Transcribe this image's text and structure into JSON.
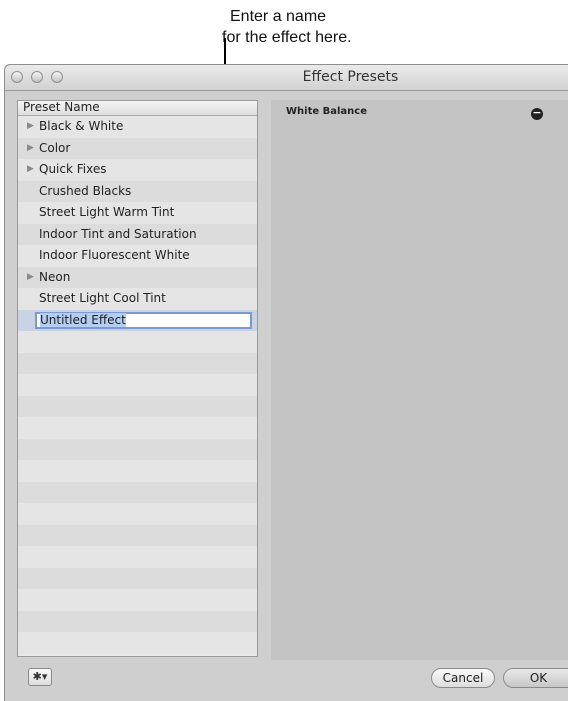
{
  "annotation": {
    "line1": "Enter a name",
    "line2": "for the effect here."
  },
  "window": {
    "title": "Effect Presets"
  },
  "presets": {
    "column_header": "Preset Name",
    "items": [
      {
        "label": "Black & White",
        "expandable": true
      },
      {
        "label": "Color",
        "expandable": true
      },
      {
        "label": "Quick Fixes",
        "expandable": true
      },
      {
        "label": "Crushed Blacks",
        "expandable": false
      },
      {
        "label": "Street Light Warm Tint",
        "expandable": false
      },
      {
        "label": "Indoor Tint and Saturation",
        "expandable": false
      },
      {
        "label": "Indoor Fluorescent White",
        "expandable": false
      },
      {
        "label": "Neon",
        "expandable": true
      },
      {
        "label": "Street Light Cool Tint",
        "expandable": false
      }
    ],
    "editing_value": "Untitled Effect"
  },
  "detail": {
    "effect_name": "White Balance",
    "remove_icon": "minus-circle-icon"
  },
  "footer": {
    "gear_icon": "gear-icon",
    "cancel_label": "Cancel",
    "ok_label": "OK"
  }
}
